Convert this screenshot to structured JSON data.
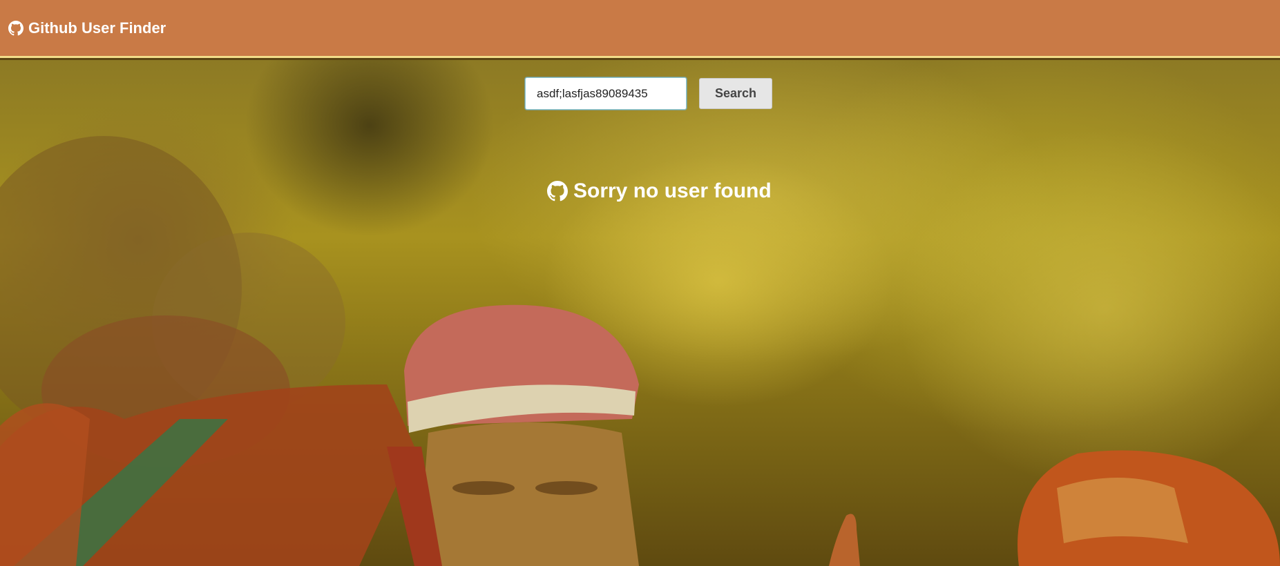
{
  "navbar": {
    "icon": "github-icon",
    "brand": "Github User Finder"
  },
  "search": {
    "value": "asdf;lasfjas89089435",
    "button_label": "Search"
  },
  "result": {
    "icon": "github-icon",
    "message": "Sorry no user found"
  },
  "colors": {
    "navbar": "#c97a46",
    "navbar_border": "#f2dd8a",
    "button": "#e6e6e6"
  }
}
